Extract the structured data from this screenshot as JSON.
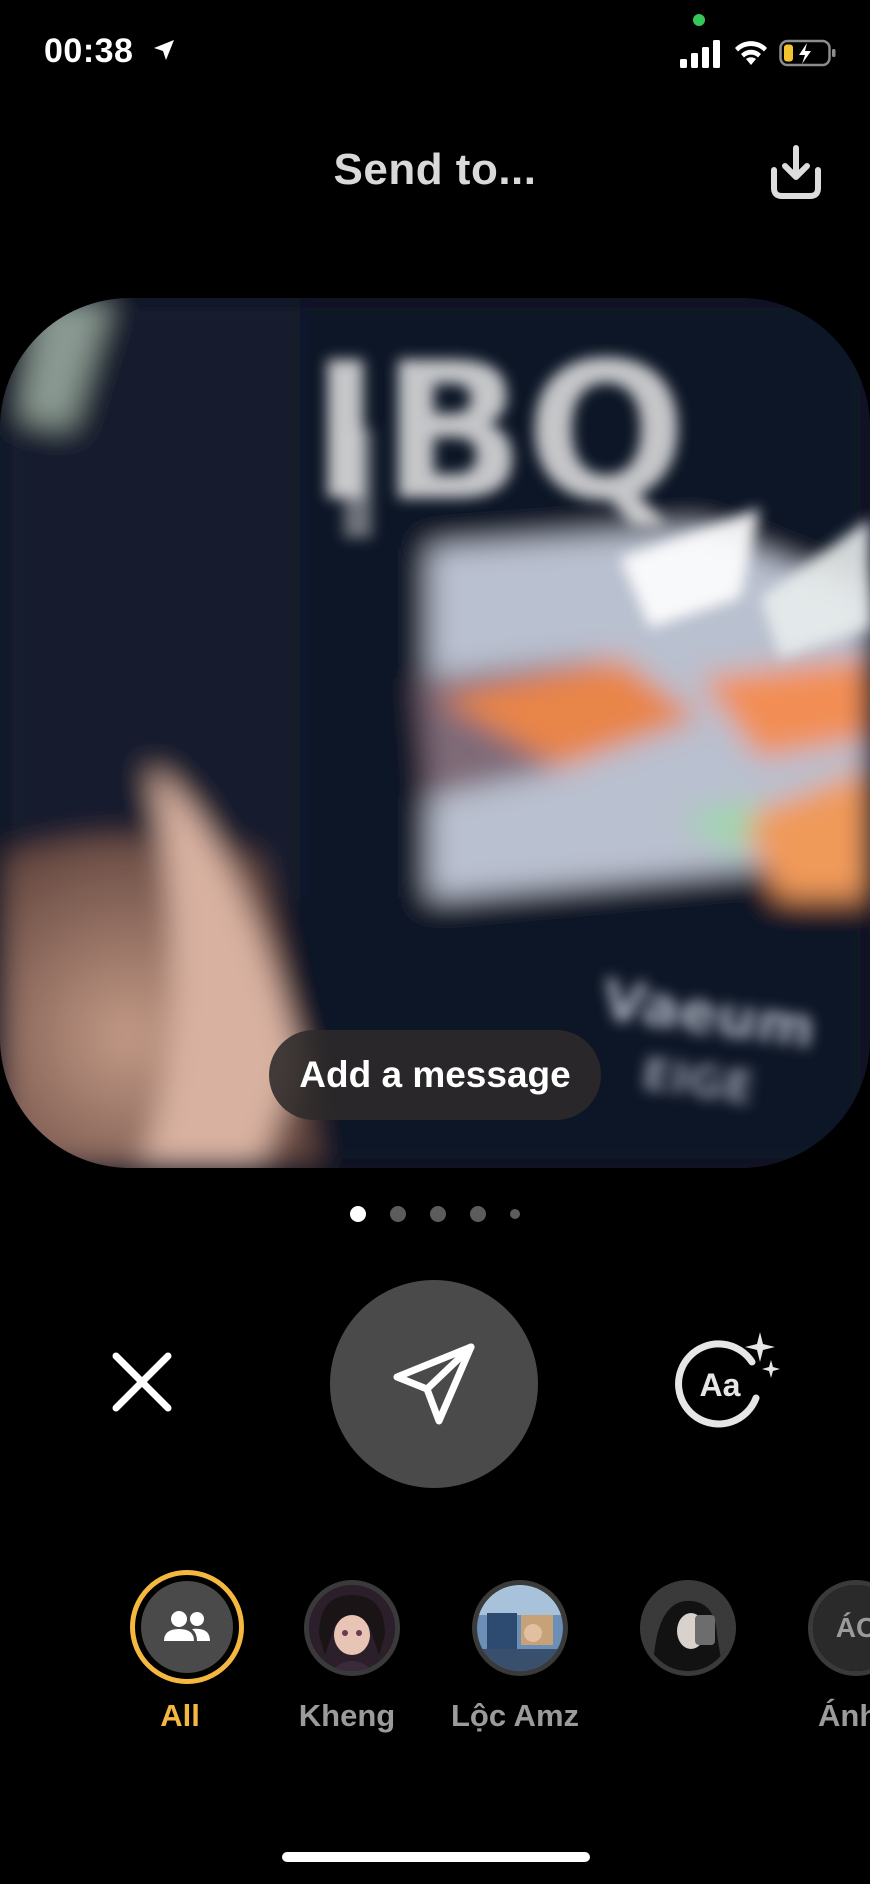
{
  "status_bar": {
    "time": "00:38",
    "icons": [
      "location-arrow-icon",
      "signal-icon",
      "wifi-icon",
      "battery-charging-icon"
    ]
  },
  "header": {
    "title": "Send to...",
    "download_icon": "download-icon"
  },
  "photo": {
    "add_message_placeholder": "Add a message"
  },
  "pager": {
    "total": 5,
    "active_index": 0
  },
  "actions": {
    "close_icon": "close-icon",
    "send_icon": "send-paper-plane-icon",
    "text_effect_icon": "text-effect-icon",
    "text_effect_label": "Aa"
  },
  "recipients": [
    {
      "label": "All",
      "selected": true,
      "icon": "group-icon"
    },
    {
      "label": "Kheng",
      "selected": false,
      "icon": "avatar"
    },
    {
      "label": "Lộc Amz",
      "selected": false,
      "icon": "avatar"
    },
    {
      "label": "",
      "selected": false,
      "icon": "avatar"
    },
    {
      "label": "Ánh",
      "selected": false,
      "icon": "avatar",
      "initials": "ÁC"
    }
  ],
  "colors": {
    "background": "#000000",
    "accent": "#f4b740",
    "send_button": "#4a4a4a",
    "muted_text": "#9b9b9b"
  }
}
